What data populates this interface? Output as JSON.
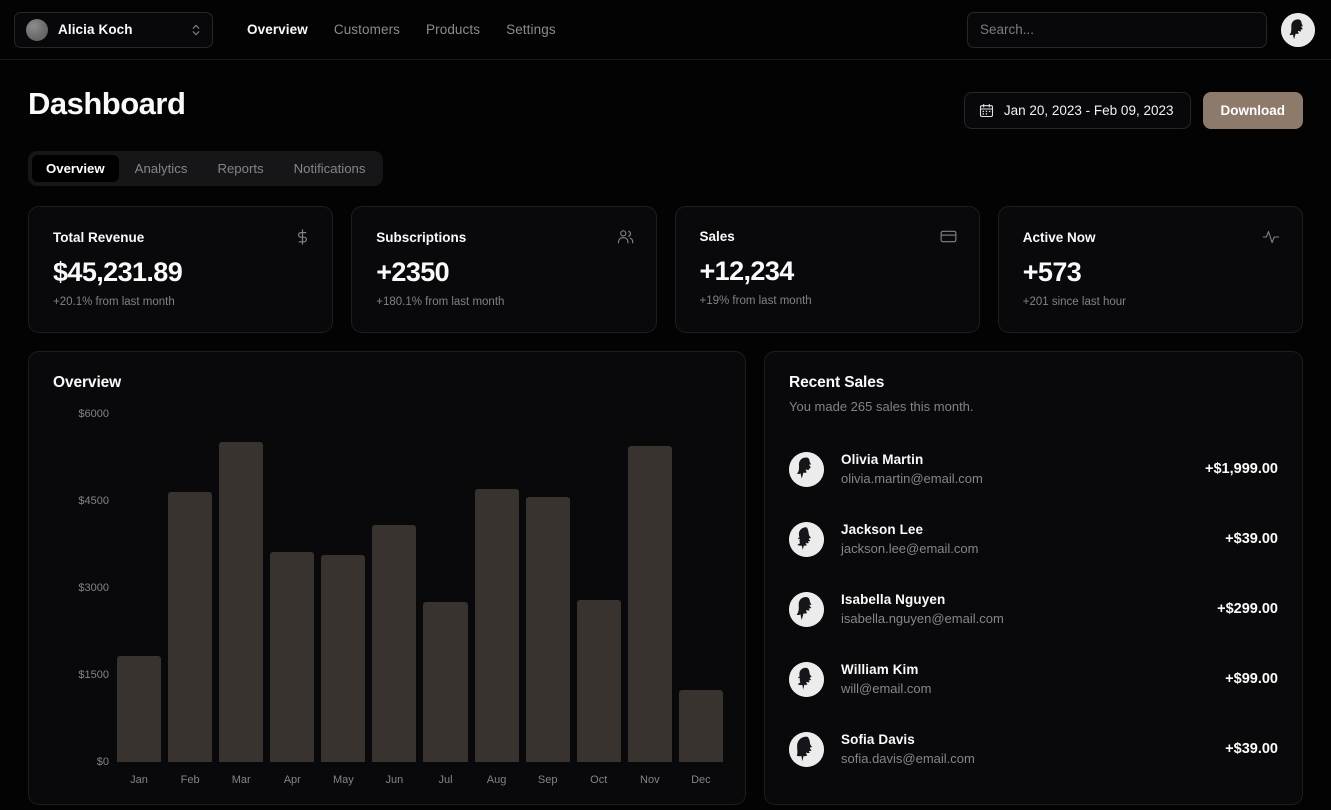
{
  "topbar": {
    "team": {
      "name": "Alicia Koch",
      "switch_icon": "chevron-up-down-icon",
      "avatar_icon": "team-avatar-icon"
    },
    "nav": [
      {
        "label": "Overview",
        "active": true
      },
      {
        "label": "Customers",
        "active": false
      },
      {
        "label": "Products",
        "active": false
      },
      {
        "label": "Settings",
        "active": false
      }
    ],
    "search": {
      "value": "",
      "placeholder": "Search..."
    },
    "user_avatar_icon": "user-avatar-icon"
  },
  "page": {
    "title": "Dashboard",
    "date_range": "Jan 20, 2023 - Feb 09, 2023",
    "calendar_icon": "calendar-icon",
    "download_label": "Download",
    "download_color": "#8e7a6b"
  },
  "tabs": [
    {
      "label": "Overview",
      "active": true
    },
    {
      "label": "Analytics",
      "active": false
    },
    {
      "label": "Reports",
      "active": false
    },
    {
      "label": "Notifications",
      "active": false
    }
  ],
  "stats": [
    {
      "title": "Total Revenue",
      "value": "$45,231.89",
      "sub": "+20.1% from last month",
      "icon": "dollar-icon"
    },
    {
      "title": "Subscriptions",
      "value": "+2350",
      "sub": "+180.1% from last month",
      "icon": "users-icon"
    },
    {
      "title": "Sales",
      "value": "+12,234",
      "sub": "+19% from last month",
      "icon": "credit-card-icon"
    },
    {
      "title": "Active Now",
      "value": "+573",
      "sub": "+201 since last hour",
      "icon": "activity-icon"
    }
  ],
  "overview": {
    "title": "Overview"
  },
  "recent_sales": {
    "title": "Recent Sales",
    "subtitle": "You made 265 sales this month.",
    "rows": [
      {
        "name": "Olivia Martin",
        "email": "olivia.martin@email.com",
        "amount": "+$1,999.00"
      },
      {
        "name": "Jackson Lee",
        "email": "jackson.lee@email.com",
        "amount": "+$39.00"
      },
      {
        "name": "Isabella Nguyen",
        "email": "isabella.nguyen@email.com",
        "amount": "+$299.00"
      },
      {
        "name": "William Kim",
        "email": "will@email.com",
        "amount": "+$99.00"
      },
      {
        "name": "Sofia Davis",
        "email": "sofia.davis@email.com",
        "amount": "+$39.00"
      }
    ]
  },
  "chart_data": {
    "type": "bar",
    "title": "Overview",
    "xlabel": "",
    "ylabel": "",
    "categories": [
      "Jan",
      "Feb",
      "Mar",
      "Apr",
      "May",
      "Jun",
      "Jul",
      "Aug",
      "Sep",
      "Oct",
      "Nov",
      "Dec"
    ],
    "values": [
      1820,
      4660,
      5520,
      3620,
      3570,
      4080,
      2760,
      4700,
      4570,
      2800,
      5450,
      1250
    ],
    "ylim": [
      0,
      6000
    ],
    "yticks": [
      0,
      1500,
      3000,
      4500,
      6000
    ],
    "ytick_labels": [
      "$0",
      "$1500",
      "$3000",
      "$4500",
      "$6000"
    ],
    "bar_color": "#38332f",
    "grid": false,
    "legend": false
  }
}
